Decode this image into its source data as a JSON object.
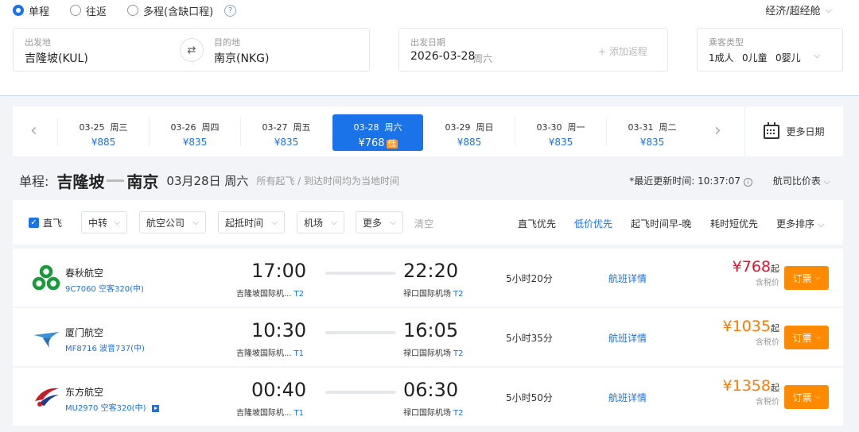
{
  "search": {
    "trip_types": [
      {
        "label": "单程",
        "selected": true
      },
      {
        "label": "往返",
        "selected": false
      },
      {
        "label": "多程(含缺口程)",
        "selected": false
      }
    ],
    "help_glyph": "?",
    "cabin": "经济/超经舱",
    "from_label": "出发地",
    "from_value": "吉隆坡(KUL)",
    "to_label": "目的地",
    "to_value": "南京(NKG)",
    "date_label": "出发日期",
    "date_value": "2026-03-28",
    "date_weekday": "周六",
    "add_return": "+ 添加返程",
    "pax_label": "乘客类型",
    "pax_adult": "1成人",
    "pax_child": "0儿童",
    "pax_infant": "0婴儿"
  },
  "dates": [
    {
      "date": "03-25",
      "weekday": "周三",
      "price": "¥885",
      "selected": false
    },
    {
      "date": "03-26",
      "weekday": "周四",
      "price": "¥835",
      "selected": false
    },
    {
      "date": "03-27",
      "weekday": "周五",
      "price": "¥835",
      "selected": false
    },
    {
      "date": "03-28",
      "weekday": "周六",
      "price": "¥768",
      "selected": true,
      "badge": "低"
    },
    {
      "date": "03-29",
      "weekday": "周日",
      "price": "¥885",
      "selected": false
    },
    {
      "date": "03-30",
      "weekday": "周一",
      "price": "¥835",
      "selected": false
    },
    {
      "date": "03-31",
      "weekday": "周二",
      "price": "¥835",
      "selected": false
    }
  ],
  "more_dates": "更多日期",
  "route": {
    "prefix": "单程:",
    "from": "吉隆坡",
    "to": "南京",
    "date": "03月28日 周六",
    "note": "所有起飞 / 到达时间均为当地时间",
    "updated_label": "*最近更新时间:",
    "updated_time": "10:37:07",
    "compare": "航司比价表"
  },
  "filters": {
    "direct": "直飞",
    "buttons": [
      "中转",
      "航空公司",
      "起抵时间",
      "机场",
      "更多"
    ],
    "clear": "清空",
    "sorts": [
      {
        "label": "直飞优先",
        "active": false
      },
      {
        "label": "低价优先",
        "active": true
      },
      {
        "label": "起飞时间早-晚",
        "active": false
      },
      {
        "label": "耗时短优先",
        "active": false
      },
      {
        "label": "更多排序",
        "active": false
      }
    ]
  },
  "flights": [
    {
      "airline": "春秋航空",
      "flight_no": "9C7060",
      "aircraft": "空客320(中)",
      "dep_time": "17:00",
      "dep_airport": "吉隆坡国际机...",
      "dep_terminal": "T2",
      "arr_time": "22:20",
      "arr_airport": "禄口国际机场",
      "arr_terminal": "T2",
      "duration": "5小时20分",
      "detail": "航班详情",
      "price": "¥768",
      "price_color": "#e8102e",
      "price_suffix": "起",
      "tax": "含税价",
      "book": "订票",
      "logo": "spring",
      "video": false
    },
    {
      "airline": "厦门航空",
      "flight_no": "MF8716",
      "aircraft": "波音737(中)",
      "dep_time": "10:30",
      "dep_airport": "吉隆坡国际机...",
      "dep_terminal": "T1",
      "arr_time": "16:05",
      "arr_airport": "禄口国际机场",
      "arr_terminal": "T2",
      "duration": "5小时35分",
      "detail": "航班详情",
      "price": "¥1035",
      "price_color": "#ff7a00",
      "price_suffix": "起",
      "tax": "含税价",
      "book": "订票",
      "logo": "xiamen",
      "video": false
    },
    {
      "airline": "东方航空",
      "flight_no": "MU2970",
      "aircraft": "空客320(中)",
      "dep_time": "00:40",
      "dep_airport": "吉隆坡国际机...",
      "dep_terminal": "T1",
      "arr_time": "06:30",
      "arr_airport": "禄口国际机场",
      "arr_terminal": "T2",
      "duration": "5小时50分",
      "detail": "航班详情",
      "price": "¥1358",
      "price_color": "#ff7a00",
      "price_suffix": "起",
      "tax": "含税价",
      "book": "订票",
      "logo": "eastern",
      "video": true
    }
  ],
  "colors": {
    "accent": "#1a73e8",
    "book": "#ff8a00",
    "low_badge": "#ff9a2e"
  }
}
